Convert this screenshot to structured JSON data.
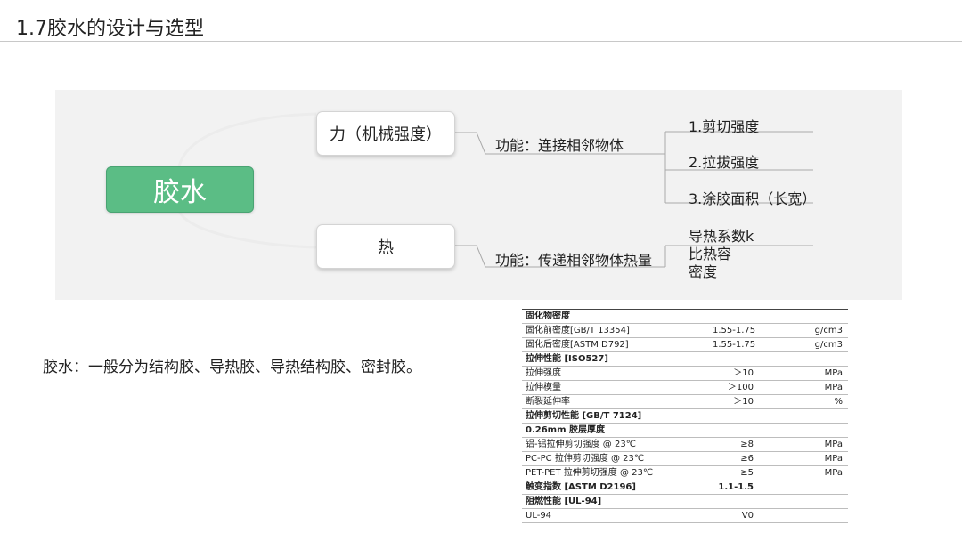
{
  "header": {
    "title": "1.7胶水的设计与选型"
  },
  "mindmap": {
    "root": "胶水",
    "branches": [
      {
        "label": "力（机械强度）",
        "function": "功能：连接相邻物体",
        "leaves": [
          "1.剪切强度",
          "2.拉拔强度",
          "3.涂胶面积（长宽）"
        ]
      },
      {
        "label": "热",
        "function": "功能：传递相邻物体热量",
        "leaves": [
          "导热系数k",
          "比热容",
          "密度"
        ]
      }
    ]
  },
  "note": "胶水：一般分为结构胶、导热胶、导热结构胶、密封胶。",
  "spec_table": {
    "rows": [
      {
        "name": "固化物密度",
        "value": "",
        "unit": "",
        "section": true
      },
      {
        "name": "固化前密度[GB/T 13354]",
        "value": "1.55-1.75",
        "unit": "g/cm3",
        "section": false
      },
      {
        "name": "固化后密度[ASTM D792]",
        "value": "1.55-1.75",
        "unit": "g/cm3",
        "section": false
      },
      {
        "name": "拉伸性能 [ISO527]",
        "value": "",
        "unit": "",
        "section": true
      },
      {
        "name": "拉伸强度",
        "value": "＞10",
        "unit": "MPa",
        "section": false
      },
      {
        "name": "拉伸模量",
        "value": "＞100",
        "unit": "MPa",
        "section": false
      },
      {
        "name": "断裂延伸率",
        "value": "＞10",
        "unit": "%",
        "section": false
      },
      {
        "name": "拉伸剪切性能 [GB/T 7124]",
        "value": "",
        "unit": "",
        "section": true
      },
      {
        "name": "0.26mm 胶层厚度",
        "value": "",
        "unit": "",
        "section": true
      },
      {
        "name": "铝-铝拉伸剪切强度 @ 23℃",
        "value": "≥8",
        "unit": "MPa",
        "section": false
      },
      {
        "name": "PC-PC 拉伸剪切强度 @ 23℃",
        "value": "≥6",
        "unit": "MPa",
        "section": false
      },
      {
        "name": "PET-PET 拉伸剪切强度 @ 23℃",
        "value": "≥5",
        "unit": "MPa",
        "section": false
      },
      {
        "name": "触变指数 [ASTM D2196]",
        "value": "1.1-1.5",
        "unit": "",
        "section": true
      },
      {
        "name": "阻燃性能 [UL-94]",
        "value": "",
        "unit": "",
        "section": true
      },
      {
        "name": "UL-94",
        "value": "V0",
        "unit": "",
        "section": false
      }
    ]
  }
}
